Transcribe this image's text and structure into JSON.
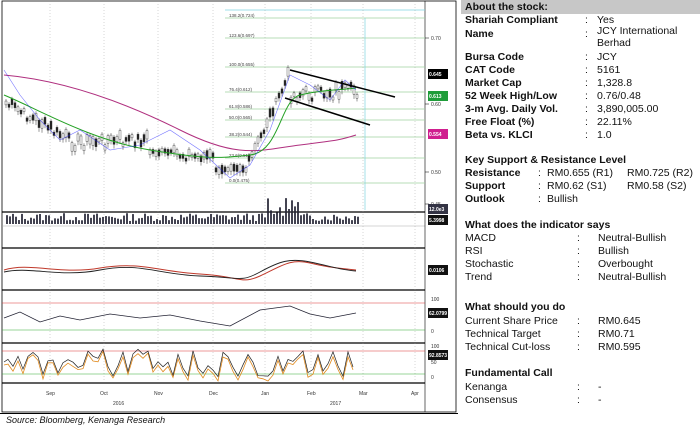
{
  "source": "Source: Bloomberg, Kenanga Research",
  "chart": {
    "y_ticks": [
      "0.70",
      "0.60",
      "0.50",
      "0.45"
    ],
    "x_months": [
      "Sep",
      "Oct",
      "Nov",
      "Dec",
      "Jan",
      "Feb",
      "Mar",
      "Apr"
    ],
    "x_years": [
      "2016",
      "2017"
    ],
    "fib_levels": [
      "138.2(0.724)",
      "123.6(0.697)",
      "100.0(0.655)",
      "76.4(0.612)",
      "61.8(0.586)",
      "50.0(0.565)",
      "38.2(0.544)",
      "23.6(0.518)",
      "0.0(0.475)"
    ],
    "price_tags": [
      "0.645",
      "0.613",
      "0.554"
    ],
    "volume_tags": [
      "12.0e3",
      "5.3998"
    ],
    "macd_tag": "0.0106",
    "rsi_tag": "62.0799",
    "stoch_tag": "92.8573",
    "rsi_ticks": [
      "100",
      "50",
      "0"
    ],
    "stoch_ticks": [
      "100",
      "50",
      "0"
    ],
    "colors": {
      "price_line": "#1a1aff",
      "ma_short": "#22a022",
      "ma_long": "#b0307f",
      "tag_black": "#000000",
      "tag_green": "#1f9d3a",
      "tag_magenta": "#d01f8f",
      "fib_line": "#9fd39f",
      "channel": "#000000"
    }
  },
  "about": {
    "header": "About the stock:",
    "items": [
      {
        "label": "Shariah Compliant",
        "colon": ":",
        "value": "Yes"
      },
      {
        "label": "Name",
        "colon": ":",
        "value": "JCY International",
        "value2": "Berhad"
      },
      {
        "label": "Bursa Code",
        "colon": ":",
        "value": "JCY"
      },
      {
        "label": "CAT Code",
        "colon": ":",
        "value": "5161"
      },
      {
        "label": "Market Cap",
        "colon": ":",
        "value": "1,328.8"
      },
      {
        "label": "52 Week High/Low",
        "colon": ":",
        "value": "0.76/0.48"
      },
      {
        "label": "3-m Avg. Daily Vol.",
        "colon": ":",
        "value": "3,890,005.00"
      },
      {
        "label": "Free Float (%)",
        "colon": ":",
        "value": "22.11%"
      },
      {
        "label": "Beta vs. KLCI",
        "colon": ":",
        "value": "1.0"
      }
    ]
  },
  "support": {
    "header": "Key Support & Resistance Level",
    "resistance_label": "Resistance",
    "resistance_value": "RM0.655 (R1)",
    "resistance_value2": "RM0.725 (R2)",
    "support_label": "Support",
    "support_value": "RM0.62 (S1)",
    "support_value2": "RM0.58 (S2)",
    "outlook_label": "Outlook",
    "outlook_value": "Bullish"
  },
  "indicator": {
    "header": "What does the indicator says",
    "items": [
      {
        "label": "MACD",
        "value": "Neutral-Bullish"
      },
      {
        "label": "RSI",
        "value": "Bullish"
      },
      {
        "label": "Stochastic",
        "value": "Overbought"
      },
      {
        "label": "Trend",
        "value": "Neutral-Bullish"
      }
    ]
  },
  "todo": {
    "header": "What should you do",
    "items": [
      {
        "label": "Current Share Price",
        "value": "RM0.645"
      },
      {
        "label": "Technical Target",
        "value": "RM0.71"
      },
      {
        "label": "Technical Cut-loss",
        "value": "RM0.595"
      }
    ]
  },
  "fundamental": {
    "header": "Fundamental Call",
    "items": [
      {
        "label": "Kenanga",
        "value": "-"
      },
      {
        "label": "Consensus",
        "value": "-"
      }
    ]
  },
  "colon_char": ":"
}
